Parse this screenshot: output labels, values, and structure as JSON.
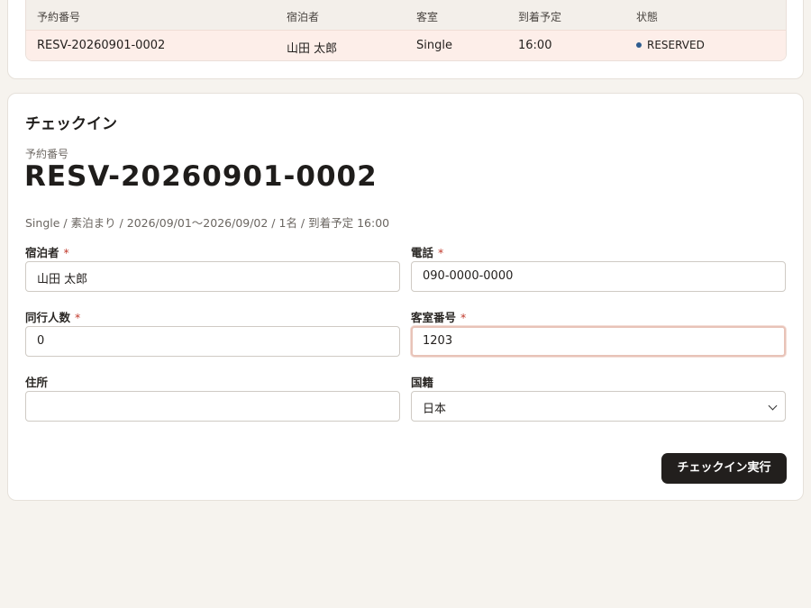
{
  "reservations_table": {
    "headers": [
      "予約番号",
      "宿泊者",
      "客室",
      "到着予定",
      "状態"
    ],
    "rows": [
      [
        "RESV-20260901-0002",
        "山田 太郎",
        "Single",
        "16:00",
        "RESERVED"
      ]
    ],
    "status_color": "#2f5c8f",
    "selected_row_color": "#fdeee9"
  },
  "checkin": {
    "title": "チェックイン",
    "reservation_label": "予約番号",
    "reservation_number": "RESV-20260901-0002",
    "summary": "Single / 素泊まり / 2026/09/01〜2026/09/02 / 1名 / 到着予定 16:00",
    "required_mark": "*",
    "fields": {
      "guest_name": {
        "label": "宿泊者",
        "value": "山田 太郎"
      },
      "phone": {
        "label": "電話",
        "value": "090-0000-0000"
      },
      "companions": {
        "label": "同行人数",
        "value": "0"
      },
      "room_number": {
        "label": "客室番号",
        "value": "1203"
      },
      "address": {
        "label": "住所",
        "value": ""
      },
      "nationality": {
        "label": "国籍",
        "value": "日本"
      }
    },
    "submit_label": "チェックイン実行"
  },
  "colors": {
    "background": "#f6f3ee",
    "button": "#221f1d",
    "required": "#c0392b",
    "focus_border": "#e8c3b8"
  }
}
